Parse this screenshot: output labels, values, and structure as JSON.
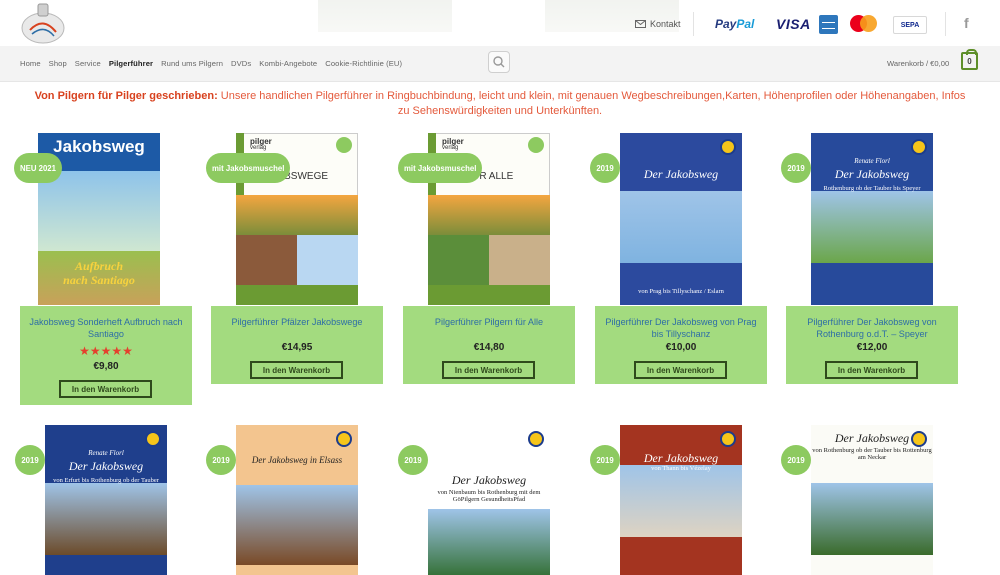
{
  "header": {
    "contact_label": "Kontakt",
    "payments": {
      "paypal_a": "Pay",
      "paypal_b": "Pal",
      "visa": "VISA",
      "sepa": "SEPA"
    },
    "facebook_glyph": "f",
    "icons": [
      "logo-icon",
      "mail-icon",
      "amex-icon",
      "mastercard-icon",
      "facebook-icon",
      "search-icon",
      "cart-icon"
    ]
  },
  "nav": {
    "items": [
      {
        "label": "Home"
      },
      {
        "label": "Shop"
      },
      {
        "label": "Service"
      },
      {
        "label": "Pilgerführer"
      },
      {
        "label": "Rund ums Pilgern"
      },
      {
        "label": "DVDs"
      },
      {
        "label": "Kombi-Angebote"
      },
      {
        "label": "Cookie-Richtlinie (EU)"
      }
    ],
    "active": "Pilgerführer",
    "cart_label": "Warenkorb / €0,00",
    "cart_count": "0"
  },
  "intro": {
    "lead": "Von Pilgern für Pilger geschrieben:",
    "text": " Unsere handlichen Pilgerführer in Ringbuchbindung, leicht und klein, mit genauen Wegbeschreibungen,Karten, Höhenprofilen oder Höhenangaben, Infos zu Sehenswürdigkeiten und Unterkünften."
  },
  "products": [
    {
      "badge": "NEU 2021",
      "title": "Jakobsweg Sonderheft Aufbruch nach Santiago",
      "rating": 5,
      "stars": "★★★★★",
      "price": "€9,80",
      "button": "In den Warenkorb",
      "cover": {
        "top_text": "Jakobsweg",
        "lines": [
          "Aufbruch",
          "nach Santiago"
        ]
      }
    },
    {
      "badge": "mit Jakobsmuschel",
      "title": "Pilgerführer Pfälzer Jakobswege",
      "price": "€14,95",
      "button": "In den Warenkorb",
      "cover": {
        "brand_top": "pilger",
        "brand_bottom": "verlag",
        "heading": "JAKOBSWEGE"
      }
    },
    {
      "badge": "mit Jakobsmuschel",
      "title": "Pilgerführer Pilgern für Alle",
      "price": "€14,80",
      "button": "In den Warenkorb",
      "cover": {
        "brand_top": "pilger",
        "brand_bottom": "verlag",
        "heading": "N FÜR ALLE"
      }
    },
    {
      "badge": "2019",
      "title": "Pilgerführer Der Jakobsweg von Prag bis Tillyschanz",
      "price": "€10,00",
      "button": "In den Warenkorb",
      "cover": {
        "heading": "Der Jakobsweg",
        "sub": "von Prag bis Tillyschanz / Eslarn"
      }
    },
    {
      "badge": "2019",
      "title": "Pilgerführer Der Jakobsweg von Rothenburg o.d.T. – Speyer",
      "price": "€12,00",
      "button": "In den Warenkorb",
      "cover": {
        "author": "Renate Florl",
        "heading": "Der Jakobsweg",
        "sub": "Rothenburg ob der Tauber bis Speyer"
      }
    },
    {
      "badge": "2019",
      "cover": {
        "author": "Renate Florl",
        "heading": "Der Jakobsweg",
        "sub": "von Erfurt bis Rothenburg ob der Tauber"
      }
    },
    {
      "badge": "2019",
      "cover": {
        "heading": "Der Jakobsweg in Elsass"
      }
    },
    {
      "badge": "2019",
      "cover": {
        "heading": "Der Jakobsweg",
        "sub": "von Nienbaum bis Rothenburg mit dem GöPilgern GesundheitsPfad"
      }
    },
    {
      "badge": "2019",
      "cover": {
        "heading": "Der Jakobsweg",
        "sub": "von Thann bis Vézelay"
      }
    },
    {
      "badge": "2019",
      "cover": {
        "heading": "Der Jakobsweg",
        "sub": "von Rothenburg ob der Tauber bis Rottenburg am Neckar"
      }
    }
  ],
  "colors": {
    "accent_green": "#a3db7f",
    "badge_green": "#8dca60",
    "title_blue": "#2e6ea6",
    "intro_red": "#e45a3c",
    "star_red": "#e4402d"
  }
}
